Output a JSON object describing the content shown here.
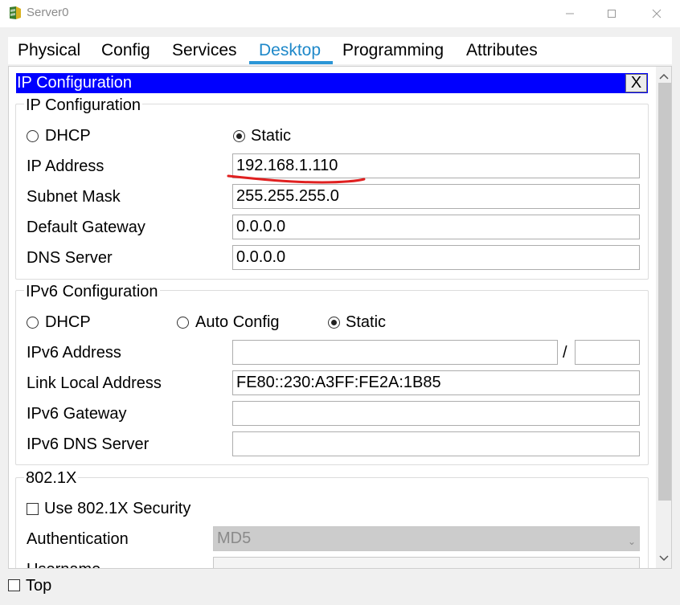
{
  "window": {
    "title": "Server0",
    "minimize_glyph": "—",
    "maximize_glyph": "☐",
    "close_glyph": "✕"
  },
  "tabs": [
    {
      "label": "Physical"
    },
    {
      "label": "Config"
    },
    {
      "label": "Services"
    },
    {
      "label": "Desktop",
      "active": true
    },
    {
      "label": "Programming"
    },
    {
      "label": "Attributes"
    }
  ],
  "panel": {
    "title": "IP Configuration",
    "close_label": "X"
  },
  "ipv4": {
    "legend": "IP Configuration",
    "mode_dhcp_label": "DHCP",
    "mode_static_label": "Static",
    "selected_mode": "Static",
    "ip_address_label": "IP Address",
    "ip_address": "192.168.1.110",
    "subnet_mask_label": "Subnet Mask",
    "subnet_mask": "255.255.255.0",
    "gateway_label": "Default Gateway",
    "gateway": "0.0.0.0",
    "dns_label": "DNS Server",
    "dns": "0.0.0.0"
  },
  "ipv6": {
    "legend": "IPv6 Configuration",
    "mode_dhcp_label": "DHCP",
    "mode_auto_label": "Auto Config",
    "mode_static_label": "Static",
    "selected_mode": "Static",
    "address_label": "IPv6 Address",
    "address": "",
    "prefix_separator": "/",
    "prefix_length": "",
    "link_local_label": "Link Local Address",
    "link_local": "FE80::230:A3FF:FE2A:1B85",
    "gateway_label": "IPv6 Gateway",
    "gateway": "",
    "dns_label": "IPv6 DNS Server",
    "dns": ""
  },
  "dot1x": {
    "legend": "802.1X",
    "use_security_label": "Use 802.1X Security",
    "use_security_checked": false,
    "authentication_label": "Authentication",
    "authentication_value": "MD5",
    "username_label": "Username"
  },
  "footer": {
    "top_label": "Top",
    "top_checked": false
  },
  "colors": {
    "panel_title_bg": "#0000ff",
    "active_tab_text": "#1e88c9",
    "active_tab_underline": "#2b96d6",
    "annotation_stroke": "#e02020"
  },
  "icons": {
    "app": "packet-tracer-server-icon",
    "scroll_up": "chevron-up-icon",
    "scroll_down": "chevron-down-icon",
    "dropdown": "dropdown-caret-icon"
  }
}
